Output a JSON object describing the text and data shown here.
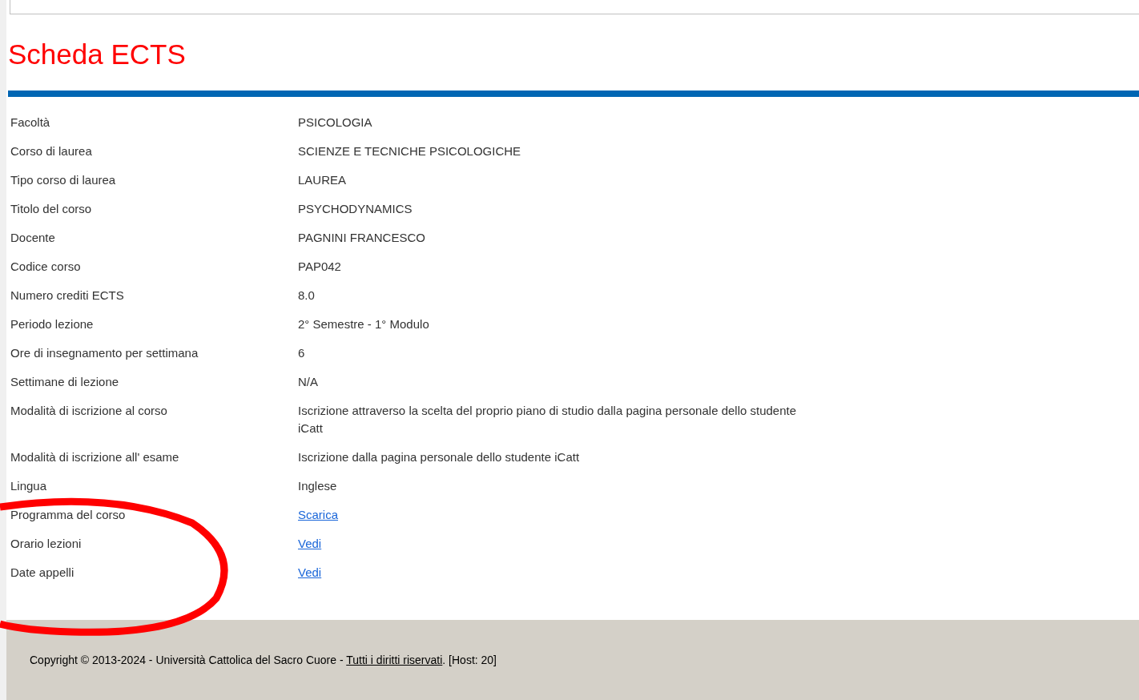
{
  "title": "Scheda ECTS",
  "rows": [
    {
      "label": "Facoltà",
      "value": "PSICOLOGIA",
      "kind": "text"
    },
    {
      "label": "Corso di laurea",
      "value": "SCIENZE E TECNICHE PSICOLOGICHE",
      "kind": "text"
    },
    {
      "label": "Tipo corso di laurea",
      "value": "LAUREA",
      "kind": "text"
    },
    {
      "label": "Titolo del corso",
      "value": "PSYCHODYNAMICS",
      "kind": "text"
    },
    {
      "label": "Docente",
      "value": "PAGNINI FRANCESCO",
      "kind": "text"
    },
    {
      "label": "Codice corso",
      "value": "PAP042",
      "kind": "text"
    },
    {
      "label": "Numero crediti ECTS",
      "value": "8.0",
      "kind": "text"
    },
    {
      "label": "Periodo lezione",
      "value": "2° Semestre - 1° Modulo",
      "kind": "text"
    },
    {
      "label": "Ore di insegnamento per settimana",
      "value": "6",
      "kind": "text"
    },
    {
      "label": "Settimane di lezione",
      "value": "N/A",
      "kind": "text"
    },
    {
      "label": "Modalità di iscrizione al corso",
      "value": "Iscrizione attraverso la scelta del proprio piano di studio dalla pagina personale dello studente iCatt",
      "kind": "text"
    },
    {
      "label": "Modalità di iscrizione all' esame",
      "value": "Iscrizione dalla pagina personale dello studente iCatt",
      "kind": "text"
    },
    {
      "label": "Lingua",
      "value": "Inglese",
      "kind": "text"
    },
    {
      "label": "Programma del corso",
      "value": "Scarica",
      "kind": "link"
    },
    {
      "label": "Orario lezioni",
      "value": "Vedi",
      "kind": "link"
    },
    {
      "label": "Date appelli",
      "value": "Vedi",
      "kind": "link"
    }
  ],
  "footer": {
    "text": "Copyright © 2013-2024 - Università Cattolica del Sacro Cuore - ",
    "link": "Tutti i diritti riservati",
    "suffix": ". [Host: 20]"
  }
}
